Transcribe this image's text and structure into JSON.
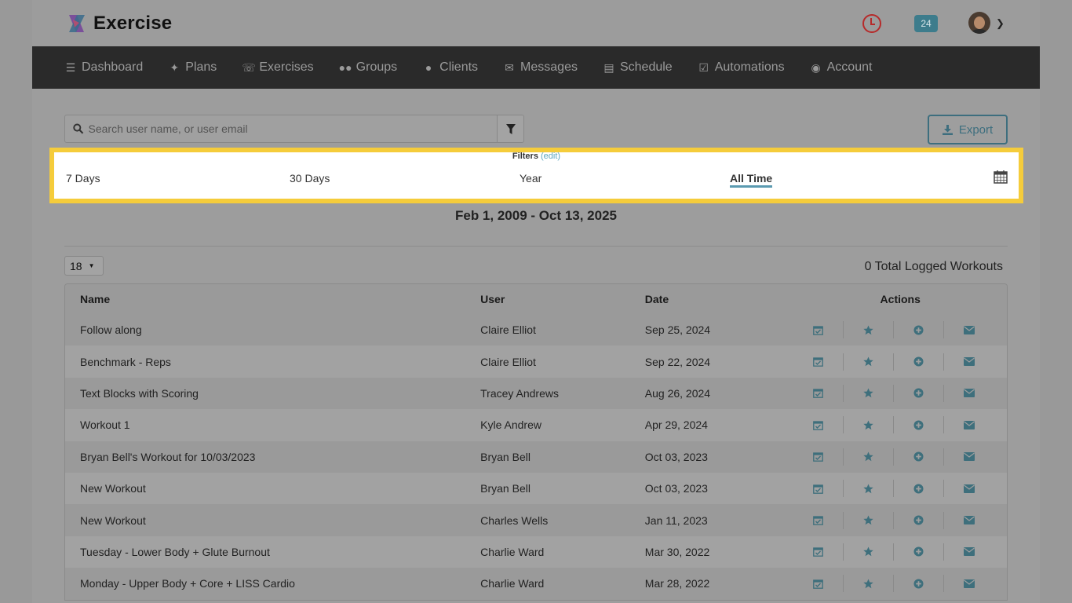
{
  "app": {
    "title": "Exercise"
  },
  "topbar": {
    "notification_count": "24"
  },
  "nav": [
    {
      "label": "Dashboard",
      "icon": "list-icon"
    },
    {
      "label": "Plans",
      "icon": "twitter-icon"
    },
    {
      "label": "Exercises",
      "icon": "phone-square-icon"
    },
    {
      "label": "Groups",
      "icon": "users-icon"
    },
    {
      "label": "Clients",
      "icon": "user-icon"
    },
    {
      "label": "Messages",
      "icon": "envelope-icon"
    },
    {
      "label": "Schedule",
      "icon": "book-icon"
    },
    {
      "label": "Automations",
      "icon": "check-square-icon"
    },
    {
      "label": "Account",
      "icon": "user-circle-icon"
    }
  ],
  "search": {
    "placeholder": "Search user name, or user email"
  },
  "export": {
    "label": "Export"
  },
  "filters": {
    "title": "Filters",
    "edit_label": "(edit)",
    "periods": [
      "7 Days",
      "30 Days",
      "Year",
      "All Time"
    ],
    "active_period": "All Time"
  },
  "date_range": "Feb 1, 2009 - Oct 13, 2025",
  "page_size": "18",
  "total_label": "0 Total Logged Workouts",
  "table": {
    "headers": {
      "name": "Name",
      "user": "User",
      "date": "Date",
      "actions": "Actions"
    },
    "rows": [
      {
        "name": "Follow along",
        "user": "Claire Elliot",
        "date": "Sep 25, 2024"
      },
      {
        "name": "Benchmark - Reps",
        "user": "Claire Elliot",
        "date": "Sep 22, 2024"
      },
      {
        "name": "Text Blocks with Scoring",
        "user": "Tracey Andrews",
        "date": "Aug 26, 2024"
      },
      {
        "name": "Workout 1",
        "user": "Kyle Andrew",
        "date": "Apr 29, 2024"
      },
      {
        "name": "Bryan Bell's Workout for 10/03/2023",
        "user": "Bryan Bell",
        "date": "Oct 03, 2023"
      },
      {
        "name": "New Workout",
        "user": "Bryan Bell",
        "date": "Oct 03, 2023"
      },
      {
        "name": "New Workout",
        "user": "Charles Wells",
        "date": "Jan 11, 2023"
      },
      {
        "name": "Tuesday - Lower Body + Glute Burnout",
        "user": "Charlie Ward",
        "date": "Mar 30, 2022"
      },
      {
        "name": "Monday - Upper Body + Core + LISS Cardio",
        "user": "Charlie Ward",
        "date": "Mar 28, 2022"
      }
    ],
    "row_actions": [
      "calendar-check-icon",
      "star-icon",
      "plus-circle-icon",
      "envelope-icon"
    ]
  },
  "colors": {
    "highlight": "#f5cc3b",
    "accent": "#3d6e7e",
    "navbar": "#2a2a2a",
    "alert": "#b62a2a"
  }
}
